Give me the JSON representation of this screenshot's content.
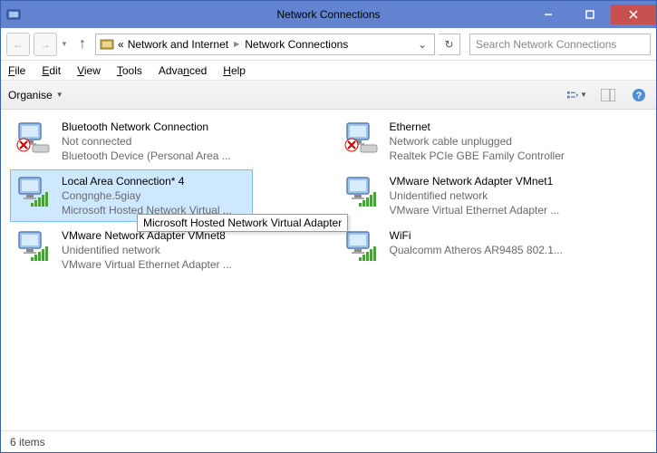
{
  "window": {
    "title": "Network Connections"
  },
  "nav": {
    "crumb_root": "«",
    "crumb1": "Network and Internet",
    "crumb2": "Network Connections",
    "search_placeholder": "Search Network Connections"
  },
  "menu": {
    "file": "File",
    "edit": "Edit",
    "view": "View",
    "tools": "Tools",
    "advanced": "Advanced",
    "help": "Help"
  },
  "toolbar": {
    "organise": "Organise"
  },
  "items": [
    {
      "name": "Bluetooth Network Connection",
      "status": "Not connected",
      "device": "Bluetooth Device (Personal Area ...",
      "state": "disabled"
    },
    {
      "name": "Ethernet",
      "status": "Network cable unplugged",
      "device": "Realtek PCIe GBE Family Controller",
      "state": "disabled"
    },
    {
      "name": "Local Area Connection* 4",
      "status": "Congnghe.5giay",
      "device": "Microsoft Hosted Network Virtual ...",
      "state": "connected",
      "selected": true
    },
    {
      "name": "VMware Network Adapter VMnet1",
      "status": "Unidentified network",
      "device": "VMware Virtual Ethernet Adapter ...",
      "state": "connected"
    },
    {
      "name": "VMware Network Adapter VMnet8",
      "status": "Unidentified network",
      "device": "VMware Virtual Ethernet Adapter ...",
      "state": "connected"
    },
    {
      "name": "WiFi",
      "status": "",
      "device": "Qualcomm Atheros AR9485 802.1...",
      "state": "connected"
    }
  ],
  "tooltip": "Microsoft Hosted Network Virtual Adapter",
  "status": {
    "count_label": "6 items"
  }
}
